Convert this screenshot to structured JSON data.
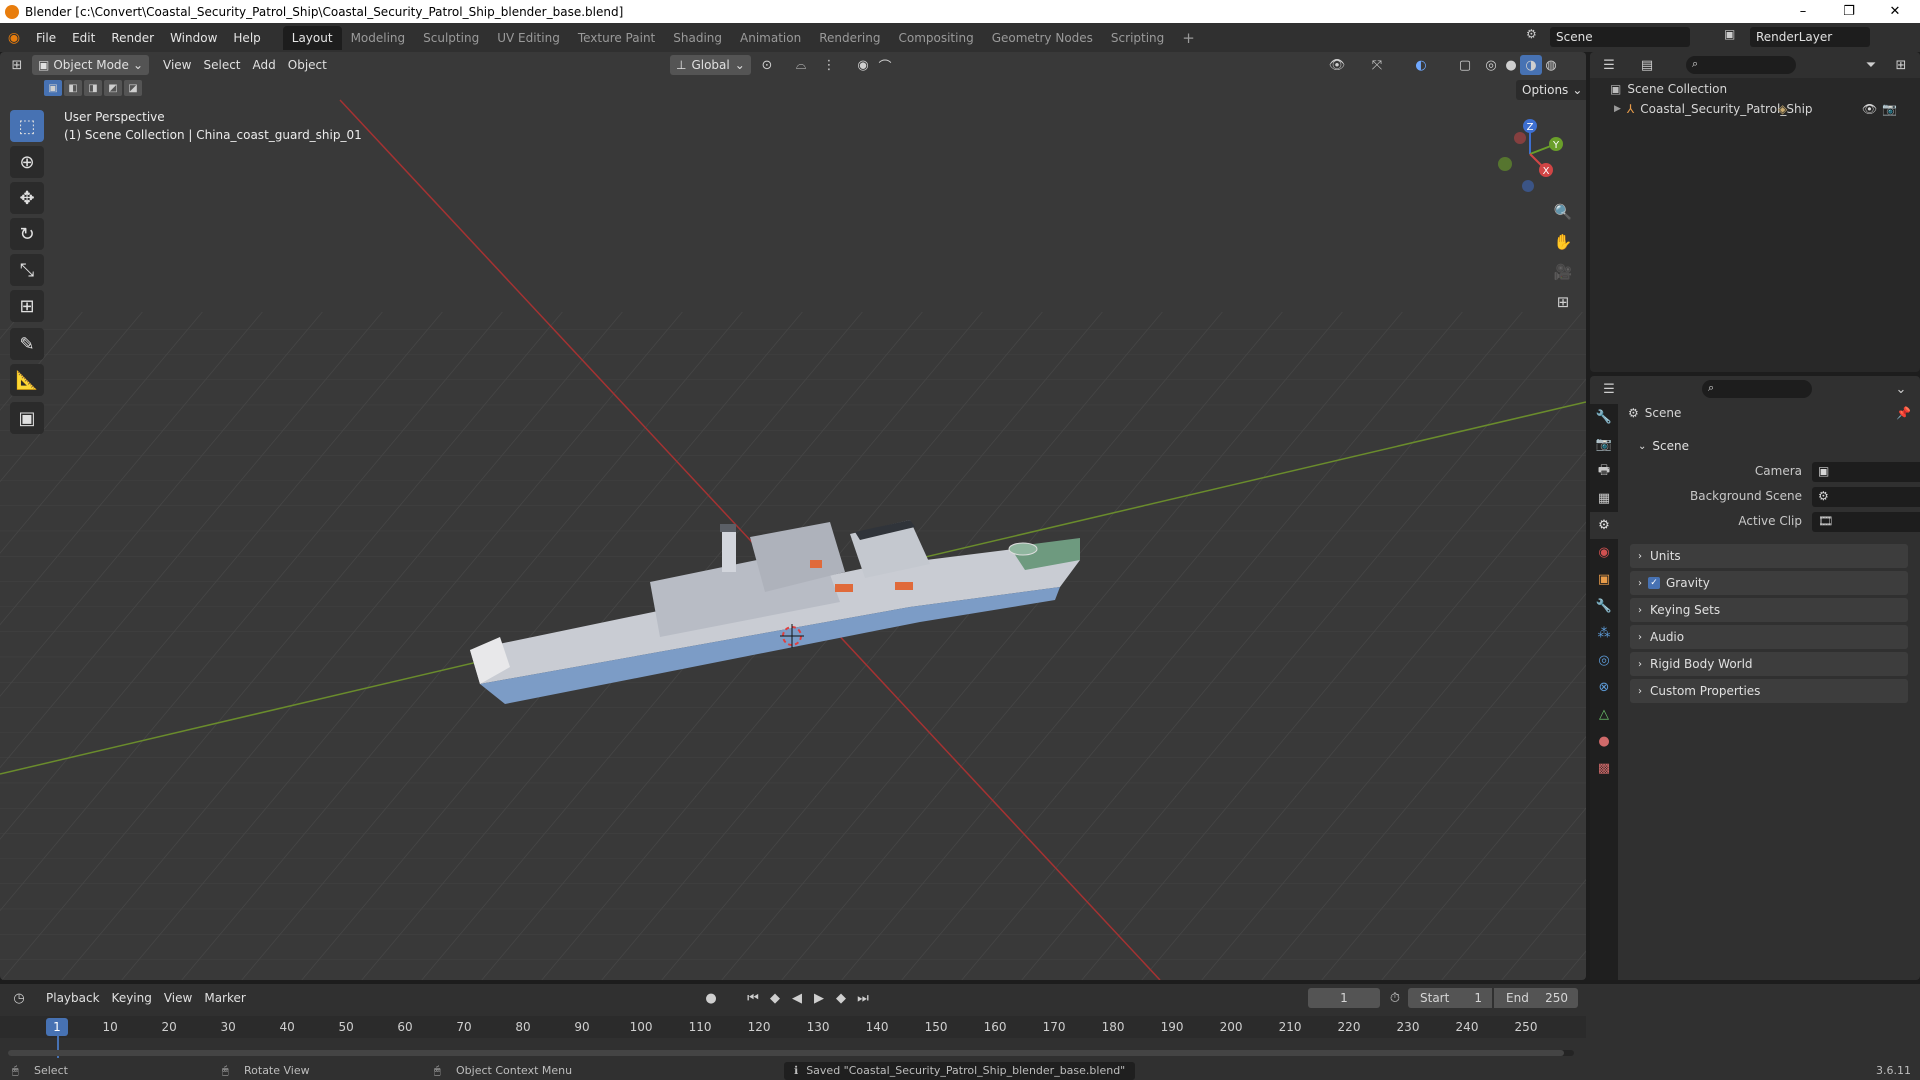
{
  "window": {
    "title": "Blender [c:\\Convert\\Coastal_Security_Patrol_Ship\\Coastal_Security_Patrol_Ship_blender_base.blend]",
    "minimize": "–",
    "maximize": "❐",
    "close": "✕"
  },
  "menu": [
    "File",
    "Edit",
    "Render",
    "Window",
    "Help"
  ],
  "workspaces": [
    "Layout",
    "Modeling",
    "Sculpting",
    "UV Editing",
    "Texture Paint",
    "Shading",
    "Animation",
    "Rendering",
    "Compositing",
    "Geometry Nodes",
    "Scripting"
  ],
  "active_workspace": "Layout",
  "scene_selector": {
    "value": "Scene"
  },
  "render_layer": {
    "value": "RenderLayer"
  },
  "viewport": {
    "mode": "Object Mode",
    "menus": [
      "View",
      "Select",
      "Add",
      "Object"
    ],
    "orientation": "Global",
    "options": "Options",
    "overlay_title": "User Perspective",
    "overlay_subtitle": "(1) Scene Collection | China_coast_guard_ship_01",
    "gizmo": {
      "x": "X",
      "y": "Y",
      "z": "Z"
    },
    "colors": {
      "background": "#393939",
      "x_axis": "#a53232",
      "y_axis": "#6a8c2c",
      "grid": "#474747"
    }
  },
  "outliner": {
    "root": "Scene Collection",
    "items": [
      {
        "label": "Coastal_Security_Patrol_Ship"
      }
    ]
  },
  "properties": {
    "header": "Scene",
    "panel_scene": "Scene",
    "fields": [
      {
        "label": "Camera"
      },
      {
        "label": "Background Scene"
      },
      {
        "label": "Active Clip"
      }
    ],
    "subpanels": [
      "Units",
      "Gravity",
      "Keying Sets",
      "Audio",
      "Rigid Body World",
      "Custom Properties"
    ],
    "gravity_checked": true
  },
  "timeline": {
    "menus": [
      "Playback",
      "Keying",
      "View",
      "Marker"
    ],
    "current_frame": "1",
    "start_label": "Start",
    "start": "1",
    "end_label": "End",
    "end": "250",
    "ticks": [
      "1",
      "10",
      "20",
      "30",
      "40",
      "50",
      "60",
      "70",
      "80",
      "90",
      "100",
      "110",
      "120",
      "130",
      "140",
      "150",
      "160",
      "170",
      "180",
      "190",
      "200",
      "210",
      "220",
      "230",
      "240",
      "250"
    ]
  },
  "status": {
    "select": "Select",
    "rotate": "Rotate View",
    "context": "Object Context Menu",
    "message": "Saved \"Coastal_Security_Patrol_Ship_blender_base.blend\"",
    "version": "3.6.11"
  }
}
